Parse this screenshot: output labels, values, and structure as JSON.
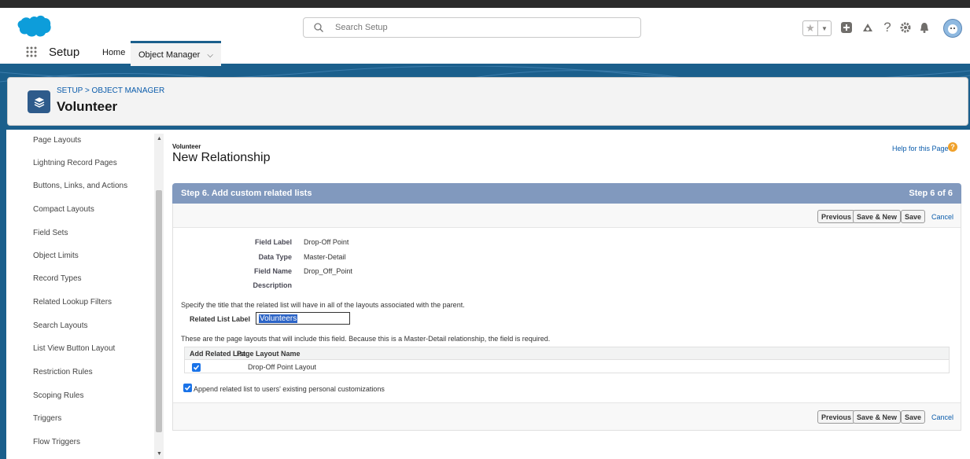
{
  "topbar": {
    "search_placeholder": "Search Setup"
  },
  "nav": {
    "app_title": "Setup",
    "tabs": [
      {
        "label": "Home"
      },
      {
        "label": "Object Manager"
      }
    ]
  },
  "header": {
    "breadcrumb": "SETUP > OBJECT MANAGER",
    "title": "Volunteer"
  },
  "sidebar": {
    "items": [
      "Page Layouts",
      "Lightning Record Pages",
      "Buttons, Links, and Actions",
      "Compact Layouts",
      "Field Sets",
      "Object Limits",
      "Record Types",
      "Related Lookup Filters",
      "Search Layouts",
      "List View Button Layout",
      "Restriction Rules",
      "Scoping Rules",
      "Triggers",
      "Flow Triggers"
    ]
  },
  "page": {
    "object_name": "Volunteer",
    "title": "New Relationship",
    "help_link": "Help for this Page",
    "step_title": "Step 6. Add custom related lists",
    "step_count": "Step 6 of 6"
  },
  "buttons": {
    "previous": "Previous",
    "save_new": "Save & New",
    "save": "Save",
    "cancel": "Cancel"
  },
  "fields": [
    {
      "label": "Field Label",
      "value": "Drop-Off Point"
    },
    {
      "label": "Data Type",
      "value": "Master-Detail"
    },
    {
      "label": "Field Name",
      "value": "Drop_Off_Point"
    },
    {
      "label": "Description",
      "value": ""
    }
  ],
  "related_list": {
    "instructions": "Specify the title that the related list will have in all of the layouts associated with the parent.",
    "label": "Related List Label",
    "value": "Volunteers"
  },
  "layouts": {
    "instructions": "These are the page layouts that will include this field. Because this is a Master-Detail relationship, the field is required.",
    "headers": [
      "Add Related List",
      "Page Layout Name"
    ],
    "rows": [
      {
        "checked": true,
        "name": "Drop-Off Point Layout"
      }
    ]
  },
  "append_option": {
    "checked": true,
    "label": "Append related list to users' existing personal customizations"
  },
  "colors": {
    "brand_blue": "#1b5f8c",
    "step_header": "#8199be",
    "link": "#0b5cab"
  }
}
